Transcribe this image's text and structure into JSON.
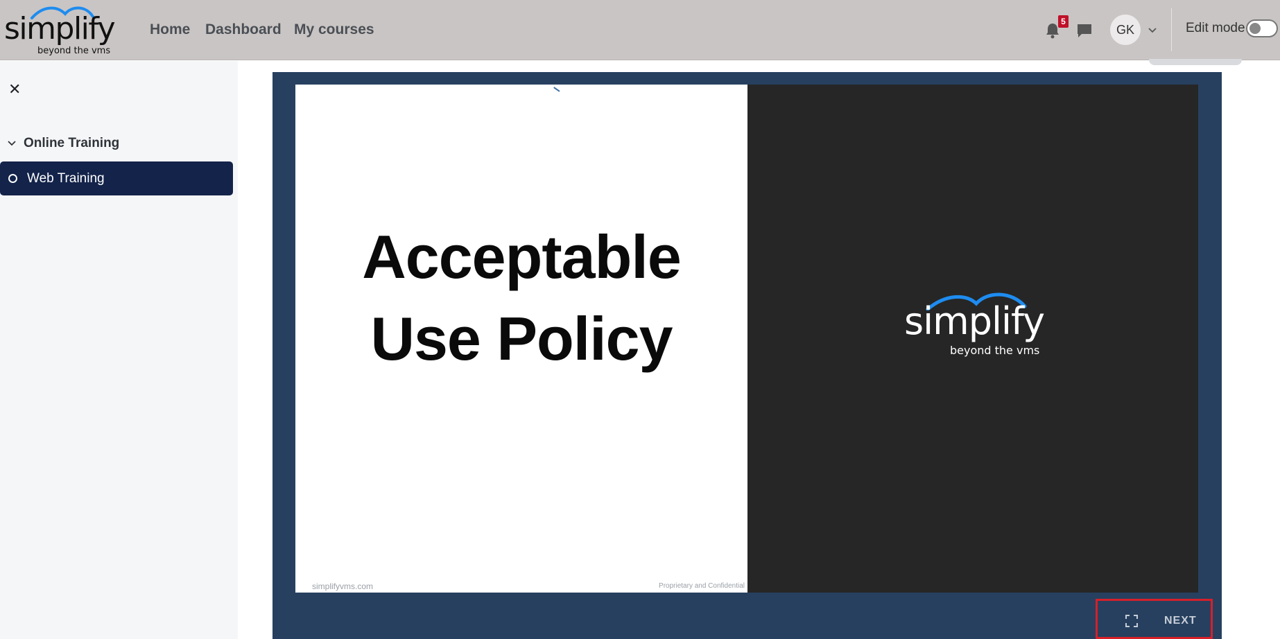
{
  "brand": {
    "wordmark": "simplify",
    "tagline": "beyond the vms"
  },
  "nav": {
    "links": [
      "Home",
      "Dashboard",
      "My courses"
    ]
  },
  "header": {
    "notifications_count": "5",
    "user_initials": "GK",
    "edit_mode_label": "Edit mode",
    "edit_mode_on": false
  },
  "sidebar": {
    "section_title": "Online Training",
    "active_item": "Web Training"
  },
  "slide": {
    "title_line1": "Acceptable",
    "title_line2": "Use Policy",
    "footer_left": "simplifyvms.com",
    "footer_right": "Proprietary and Confidential",
    "logo_wordmark": "simplify",
    "logo_tagline": "beyond the vms"
  },
  "player": {
    "next_label": "NEXT"
  },
  "colors": {
    "navbar": "#c9c5c4",
    "sidebar_active": "#13234a",
    "player_bg": "#27405f",
    "brand_blue": "#1e8cf0",
    "highlight": "#d6202a"
  }
}
